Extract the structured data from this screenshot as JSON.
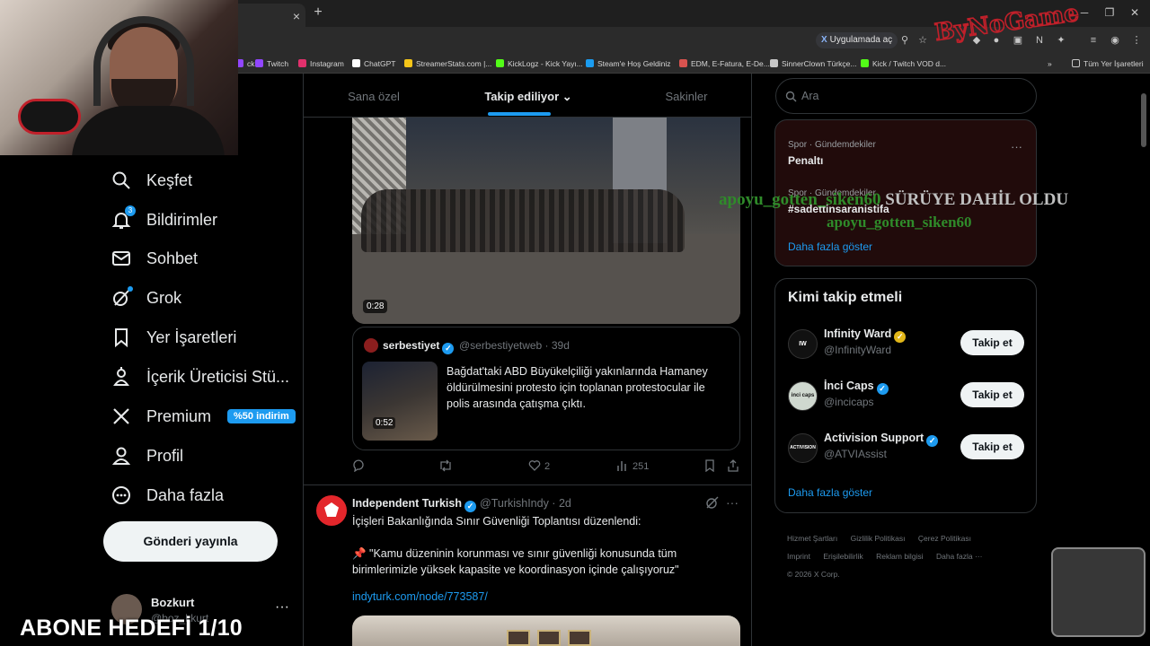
{
  "browser": {
    "tab_close": "×",
    "new_tab": "+",
    "open_in_app": "Uygulamada aç",
    "bookmarks": [
      {
        "label": "ck",
        "color": "#9146ff"
      },
      {
        "label": "Twitch",
        "color": "#9146ff"
      },
      {
        "label": "Instagram",
        "color": "#e1306c"
      },
      {
        "label": "ChatGPT",
        "color": "#ffffff"
      },
      {
        "label": "StreamerStats.com |...",
        "color": "#f5c518"
      },
      {
        "label": "KickLogz - Kick Yayı...",
        "color": "#53fc18"
      },
      {
        "label": "Steam'e Hoş Geldiniz",
        "color": "#1b9cf0"
      },
      {
        "label": "EDM, E-Fatura, E-De...",
        "color": "#d9534f"
      },
      {
        "label": "SinnerClown Türkçe...",
        "color": "#c7c7c7"
      },
      {
        "label": "Kick / Twitch VOD d...",
        "color": "#53fc18"
      }
    ],
    "all_bookmarks": "Tüm Yer İşaretleri"
  },
  "overlay": {
    "logo": "ByNoGame",
    "goal": "ABONE HEDEFİ 1/10",
    "ticker_user": "apoyu_gotten_siken60",
    "ticker_msg": " SÜRÜYE DAHİL OLDU",
    "ticker_user2": "apoyu_gotten_siken60"
  },
  "nav": {
    "items": [
      {
        "label": "Keşfet",
        "icon": "search-icon"
      },
      {
        "label": "Bildirimler",
        "icon": "bell-icon",
        "badge": "3"
      },
      {
        "label": "Sohbet",
        "icon": "mail-icon"
      },
      {
        "label": "Grok",
        "icon": "grok-icon"
      },
      {
        "label": "Yer İşaretleri",
        "icon": "bookmark-icon"
      },
      {
        "label": "İçerik Üreticisi Stü...",
        "icon": "creator-studio-icon"
      },
      {
        "label": "Premium",
        "icon": "x-logo-icon",
        "promo": "%50 indirim"
      },
      {
        "label": "Profil",
        "icon": "profile-icon"
      },
      {
        "label": "Daha fazla",
        "icon": "more-circle-icon"
      }
    ],
    "post_button": "Gönderi yayınla",
    "account": {
      "name": "Bozkurt",
      "handle": "@boz_kkurt",
      "more": "···"
    }
  },
  "feed": {
    "tabs": [
      "Sana özel",
      "Takip ediliyor",
      "Sakinler"
    ],
    "active_tab": "Takip ediliyor",
    "post1": {
      "video_duration": "0:28",
      "quote": {
        "name": "serbestiyet",
        "handle": "@serbestiyetweb · 39d",
        "thumb_duration": "0:52",
        "text": "Bağdat'taki ABD Büyükelçiliği yakınlarında Hamaney öldürülmesini protesto için toplanan protestocular ile polis arasında çatışma çıktı."
      },
      "actions": {
        "likes": "2",
        "views": "251"
      }
    },
    "post2": {
      "name": "Independent Turkish",
      "handle": "@TurkishIndy · 2d",
      "text": "İçişleri Bakanlığında Sınır Güvenliği Toplantısı düzenlendi:\n\n📌 \"Kamu düzeninin korunması ve sınır güvenliği konusunda tüm birimlerimizle yüksek kapasite ve koordinasyon içinde çalışıyoruz\"",
      "link": "indyturk.com/node/773587/"
    }
  },
  "right": {
    "search_placeholder": "Ara",
    "trends": [
      {
        "meta": "Spor · Gündemdekiler",
        "title": "Penaltı"
      },
      {
        "meta": "Spor · Gündemdekiler",
        "title": "#sadettinsaranistifa"
      }
    ],
    "show_more": "Daha fazla göster",
    "who_to_follow": {
      "title": "Kimi takip etmeli",
      "users": [
        {
          "name": "Infinity Ward",
          "handle": "@InfinityWard",
          "badge": "gold",
          "avatar": "IW"
        },
        {
          "name": "İnci Caps",
          "handle": "@incicaps",
          "badge": "blue",
          "avatar": "inci caps"
        },
        {
          "name": "Activision Support",
          "handle": "@ATVIAssist",
          "badge": "blue",
          "avatar": "ACTIVISION"
        }
      ],
      "follow_label": "Takip et",
      "show_more": "Daha fazla göster"
    },
    "footer": [
      "Hizmet Şartları",
      "Gizlilik Politikası",
      "Çerez Politikası",
      "Imprint",
      "Erişilebilirlik",
      "Reklam bilgisi",
      "Daha fazla ···",
      "© 2026 X Corp."
    ]
  }
}
